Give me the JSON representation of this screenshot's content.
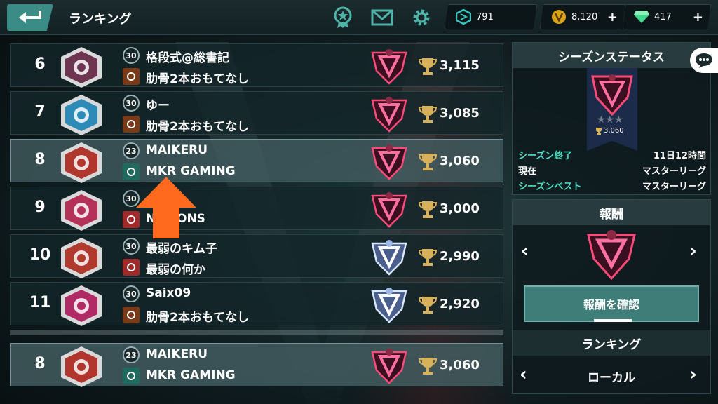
{
  "header": {
    "title": "ランキング",
    "icons": [
      "medal-icon",
      "mail-icon",
      "gear-icon"
    ],
    "currencies": [
      {
        "name": "token-icon",
        "value": "791",
        "color": "#39c5c0",
        "has_plus": false
      },
      {
        "name": "gold-coin-icon",
        "value": "8,120",
        "color": "#d9a21b",
        "has_plus": true
      },
      {
        "name": "gem-icon",
        "value": "417",
        "color": "#3fd88b",
        "has_plus": true
      }
    ]
  },
  "ranking": {
    "rows": [
      {
        "rank": "6",
        "level": "30",
        "player": "格段式@総書記",
        "guild": "肋骨2本おもてなし",
        "score": "3,115",
        "emblem": "demon-emblem-icon",
        "emblem_color": "#6d3550",
        "league": "master"
      },
      {
        "rank": "7",
        "level": "30",
        "player": "ゆー",
        "guild": "肋骨2本おもてなし",
        "score": "3,085",
        "emblem": "bear-emblem-icon",
        "emblem_color": "#2e8bb8",
        "league": "master"
      },
      {
        "rank": "8",
        "level": "23",
        "player": "MAIKERU",
        "guild": "MKR GAMING",
        "score": "3,060",
        "emblem": "crossed-swords-emblem-icon",
        "emblem_color": "#b0362e",
        "league": "master",
        "highlight": true
      },
      {
        "rank": "9",
        "level": "30",
        "player": "",
        "guild": "NATIONS",
        "score": "3,000",
        "emblem": "skull-emblem-icon",
        "emblem_color": "#b4315a",
        "league": "master"
      },
      {
        "rank": "10",
        "level": "30",
        "player": "最弱のキム子",
        "guild": "最弱の何か",
        "score": "2,990",
        "emblem": "mountain-emblem-icon",
        "emblem_color": "#b13a2f",
        "league": "diamond"
      },
      {
        "rank": "11",
        "level": "30",
        "player": "Saix09",
        "guild": "肋骨2本おもてなし",
        "score": "2,920",
        "emblem": "dragon-emblem-icon",
        "emblem_color": "#b02a66",
        "league": "diamond"
      }
    ],
    "my_row": {
      "rank": "8",
      "level": "23",
      "player": "MAIKERU",
      "guild": "MKR GAMING",
      "score": "3,060",
      "emblem": "crossed-swords-emblem-icon",
      "emblem_color": "#b0362e",
      "league": "master"
    }
  },
  "season": {
    "title": "シーズンステータス",
    "banner_score": "3,060",
    "rows": [
      {
        "label": "シーズン終了",
        "value": "11日12時間",
        "accent": true
      },
      {
        "label": "現在",
        "value": "マスターリーグ",
        "accent": false
      },
      {
        "label": "シーズンベスト",
        "value": "マスターリーグ",
        "accent": true
      }
    ]
  },
  "reward": {
    "title": "報酬",
    "confirm_label": "報酬を確認",
    "ranking_title": "ランキング",
    "region": "ローカル"
  },
  "colors": {
    "accent": "#3f7d78",
    "highlight_arrow": "#ff6a1f",
    "trophy": "#d7b25a"
  }
}
